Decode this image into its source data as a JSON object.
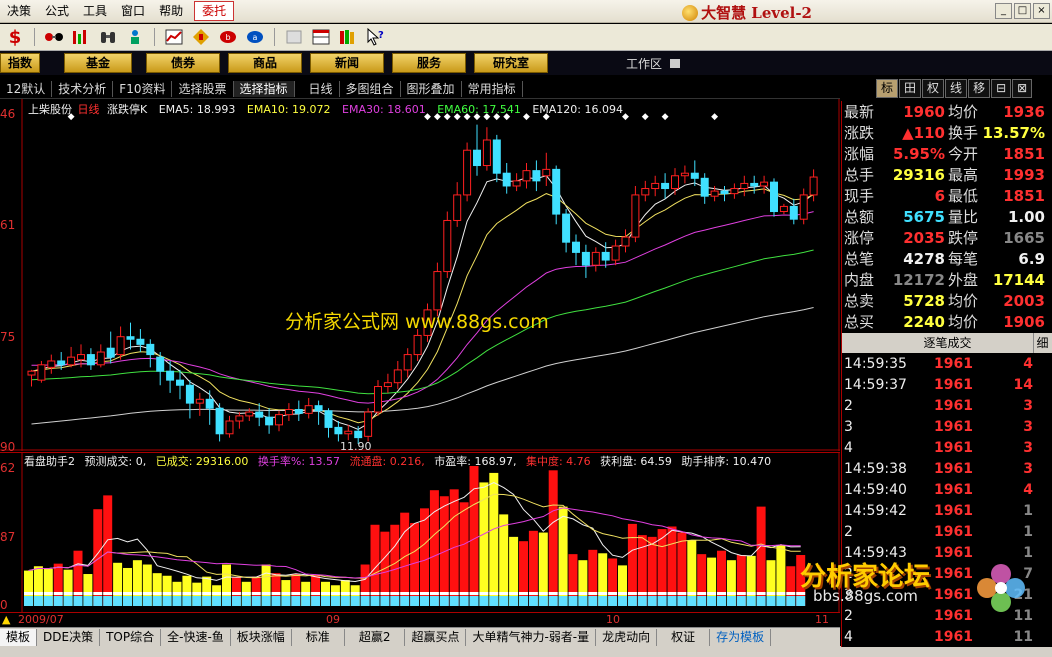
{
  "menu": {
    "items": [
      "决策",
      "公式",
      "工具",
      "窗口",
      "帮助"
    ],
    "active": "委托",
    "brand": "大智慧 Level-2",
    "controls": [
      "_",
      "□",
      "×"
    ]
  },
  "nav": {
    "items": [
      "指数",
      "基金",
      "债券",
      "商品",
      "新闻",
      "服务",
      "研究室"
    ],
    "workarea": "工作区"
  },
  "subtabs": {
    "items": [
      "12默认",
      "技术分析",
      "F10资料",
      "选择股票",
      "选择指标",
      "日线",
      "多图组合",
      "图形叠加",
      "常用指标"
    ],
    "active": "选择指标"
  },
  "right_tabs": {
    "items": [
      "标",
      "田",
      "权",
      "线",
      "移",
      "⊟",
      "⊠"
    ],
    "active": "标"
  },
  "chart_info": {
    "name": "上柴股份",
    "period": "日线",
    "limit": "涨跌停K",
    "ema5": "EMA5: 18.993",
    "ema10": "EMA10: 19.072",
    "ema30": "EMA30: 18.601",
    "ema60": "EMA60: 17.541",
    "ema120": "EMA120: 16.094"
  },
  "price_axis": [
    "46",
    "61",
    "75",
    "90"
  ],
  "volume_axis": [
    "62",
    "87",
    "0"
  ],
  "low_label": "11.90",
  "watermark": "分析家公式网 www.88gs.com",
  "vol_info": {
    "name": "看盘助手2",
    "forecast": "预测成交: 0,",
    "done": "已成交: 29316.00",
    "turnover": "换手率%: 13.57",
    "flow": "流通盘: 0.216,",
    "pe": "市盈率: 168.97,",
    "conc": "集中度: 4.76",
    "profit": "获利盘: 64.59",
    "rank": "助手排序: 10.470"
  },
  "x_axis": [
    "2009/07",
    "09",
    "10",
    "11"
  ],
  "bottom_tabs": {
    "items": [
      "模板",
      "DDE决策",
      "TOP综合",
      "全-快速-鱼",
      "板块涨幅",
      "标准",
      "超赢2",
      "超赢买点",
      "大单精气神力-弱者-量",
      "龙虎动向",
      "权证",
      "存为模板"
    ],
    "active": "模板"
  },
  "quote": {
    "rows": [
      {
        "l1": "最新",
        "v1": "1960",
        "c1": "red",
        "l2": "均价",
        "v2": "1936",
        "c2": "red"
      },
      {
        "l1": "涨跌",
        "v1": "▲110",
        "c1": "red",
        "l2": "换手",
        "v2": "13.57%",
        "c2": "yel"
      },
      {
        "l1": "涨幅",
        "v1": "5.95%",
        "c1": "red",
        "l2": "今开",
        "v2": "1851",
        "c2": "red"
      },
      {
        "l1": "总手",
        "v1": "29316",
        "c1": "yel",
        "l2": "最高",
        "v2": "1993",
        "c2": "red"
      },
      {
        "l1": "现手",
        "v1": "6",
        "c1": "red",
        "l2": "最低",
        "v2": "1851",
        "c2": "red"
      },
      {
        "l1": "总额",
        "v1": "5675",
        "c1": "cyn",
        "l2": "量比",
        "v2": "1.00",
        "c2": "wht"
      },
      {
        "l1": "涨停",
        "v1": "2035",
        "c1": "red",
        "l2": "跌停",
        "v2": "1665",
        "c2": "gry"
      },
      {
        "l1": "总笔",
        "v1": "4278",
        "c1": "wht",
        "l2": "每笔",
        "v2": "6.9",
        "c2": "wht"
      },
      {
        "l1": "内盘",
        "v1": "12172",
        "c1": "gry",
        "l2": "外盘",
        "v2": "17144",
        "c2": "yel"
      },
      {
        "l1": "总卖",
        "v1": "5728",
        "c1": "yel",
        "l2": "均价",
        "v2": "2003",
        "c2": "red"
      },
      {
        "l1": "总买",
        "v1": "2240",
        "c1": "yel",
        "l2": "均价",
        "v2": "1906",
        "c2": "red"
      }
    ],
    "tick_title": "逐笔成交",
    "tick_btn": "细",
    "ticks": [
      {
        "t": "14:59:35",
        "p": "1961",
        "v": "4",
        "c": "red"
      },
      {
        "t": "14:59:37",
        "p": "1961",
        "v": "14",
        "c": "red"
      },
      {
        "t": "2",
        "p": "1961",
        "v": "3",
        "c": "red"
      },
      {
        "t": "3",
        "p": "1961",
        "v": "3",
        "c": "red"
      },
      {
        "t": "4",
        "p": "1961",
        "v": "3",
        "c": "red"
      },
      {
        "t": "14:59:38",
        "p": "1961",
        "v": "3",
        "c": "red"
      },
      {
        "t": "14:59:40",
        "p": "1961",
        "v": "4",
        "c": "red"
      },
      {
        "t": "14:59:42",
        "p": "1961",
        "v": "1",
        "c": "gry"
      },
      {
        "t": "2",
        "p": "1961",
        "v": "1",
        "c": "gry"
      },
      {
        "t": "14:59:43",
        "p": "1961",
        "v": "1",
        "c": "gry"
      },
      {
        "t": "2",
        "p": "1961",
        "v": "7",
        "c": "gry"
      },
      {
        "t": "3",
        "p": "1961",
        "v": "21",
        "c": "gry"
      },
      {
        "t": "2",
        "p": "1961",
        "v": "11",
        "c": "gry"
      },
      {
        "t": "4",
        "p": "1961",
        "v": "11",
        "c": "gry"
      }
    ]
  },
  "logo2": {
    "text": "分析家论坛",
    "url": "bbs.88gs.com"
  },
  "chart_data": {
    "type": "candlestick",
    "price_ylim": [
      16.9,
      19.46
    ],
    "candles": [
      [
        17.44,
        17.47,
        17.35,
        17.48
      ],
      [
        17.4,
        17.52,
        17.38,
        17.55
      ],
      [
        17.5,
        17.55,
        17.45,
        17.6
      ],
      [
        17.55,
        17.52,
        17.48,
        17.62
      ],
      [
        17.52,
        17.58,
        17.5,
        17.66
      ],
      [
        17.56,
        17.6,
        17.5,
        17.68
      ],
      [
        17.6,
        17.52,
        17.48,
        17.65
      ],
      [
        17.52,
        17.62,
        17.5,
        17.68
      ],
      [
        17.65,
        17.58,
        17.53,
        17.78
      ],
      [
        17.6,
        17.74,
        17.56,
        17.82
      ],
      [
        17.74,
        17.72,
        17.64,
        17.85
      ],
      [
        17.72,
        17.68,
        17.62,
        17.8
      ],
      [
        17.68,
        17.6,
        17.5,
        17.72
      ],
      [
        17.58,
        17.47,
        17.36,
        17.62
      ],
      [
        17.47,
        17.4,
        17.3,
        17.55
      ],
      [
        17.4,
        17.36,
        17.25,
        17.48
      ],
      [
        17.36,
        17.22,
        17.1,
        17.4
      ],
      [
        17.22,
        17.25,
        17.12,
        17.3
      ],
      [
        17.25,
        17.18,
        17.05,
        17.32
      ],
      [
        17.18,
        16.98,
        16.92,
        17.22
      ],
      [
        16.98,
        17.08,
        16.95,
        17.12
      ],
      [
        17.08,
        17.12,
        17.02,
        17.15
      ],
      [
        17.12,
        17.15,
        17.08,
        17.18
      ],
      [
        17.15,
        17.11,
        17.04,
        17.22
      ],
      [
        17.11,
        17.05,
        16.98,
        17.18
      ],
      [
        17.05,
        17.13,
        17.0,
        17.16
      ],
      [
        17.13,
        17.17,
        17.08,
        17.22
      ],
      [
        17.17,
        17.14,
        17.08,
        17.24
      ],
      [
        17.14,
        17.2,
        17.1,
        17.26
      ],
      [
        17.2,
        17.16,
        17.05,
        17.24
      ],
      [
        17.16,
        17.03,
        16.95,
        17.18
      ],
      [
        17.03,
        16.98,
        16.92,
        17.08
      ],
      [
        16.98,
        17.0,
        16.93,
        17.05
      ],
      [
        17.0,
        16.95,
        16.9,
        17.04
      ],
      [
        16.96,
        17.15,
        16.92,
        17.18
      ],
      [
        17.15,
        17.35,
        17.12,
        17.4
      ],
      [
        17.35,
        17.38,
        17.3,
        17.45
      ],
      [
        17.38,
        17.48,
        17.33,
        17.55
      ],
      [
        17.48,
        17.6,
        17.42,
        17.65
      ],
      [
        17.6,
        17.75,
        17.55,
        17.8
      ],
      [
        17.75,
        17.95,
        17.7,
        18.0
      ],
      [
        17.95,
        18.25,
        17.9,
        18.32
      ],
      [
        18.25,
        18.65,
        18.2,
        18.72
      ],
      [
        18.65,
        18.85,
        18.6,
        18.95
      ],
      [
        18.85,
        19.2,
        18.8,
        19.26
      ],
      [
        19.2,
        19.08,
        19.0,
        19.4
      ],
      [
        19.08,
        19.28,
        19.04,
        19.38
      ],
      [
        19.28,
        19.02,
        18.95,
        19.32
      ],
      [
        19.02,
        18.92,
        18.86,
        19.1
      ],
      [
        18.92,
        18.96,
        18.88,
        19.02
      ],
      [
        18.96,
        19.04,
        18.9,
        19.1
      ],
      [
        19.04,
        18.96,
        18.88,
        19.12
      ],
      [
        19.0,
        19.05,
        18.92,
        19.18
      ],
      [
        19.05,
        18.7,
        18.62,
        19.08
      ],
      [
        18.7,
        18.48,
        18.4,
        18.74
      ],
      [
        18.48,
        18.4,
        18.3,
        18.54
      ],
      [
        18.4,
        18.3,
        18.2,
        18.46
      ],
      [
        18.3,
        18.4,
        18.25,
        18.44
      ],
      [
        18.4,
        18.34,
        18.28,
        18.48
      ],
      [
        18.34,
        18.45,
        18.3,
        18.5
      ],
      [
        18.45,
        18.52,
        18.4,
        18.58
      ],
      [
        18.52,
        18.85,
        18.48,
        18.92
      ],
      [
        18.85,
        18.9,
        18.8,
        18.96
      ],
      [
        18.9,
        18.94,
        18.84,
        19.0
      ],
      [
        18.94,
        18.9,
        18.82,
        19.02
      ],
      [
        18.9,
        19.0,
        18.85,
        19.06
      ],
      [
        19.0,
        19.02,
        18.94,
        19.08
      ],
      [
        19.02,
        18.98,
        18.92,
        19.12
      ],
      [
        18.98,
        18.84,
        18.78,
        19.02
      ],
      [
        18.84,
        18.88,
        18.8,
        18.92
      ],
      [
        18.88,
        18.86,
        18.8,
        18.92
      ],
      [
        18.86,
        18.9,
        18.82,
        18.94
      ],
      [
        18.9,
        18.94,
        18.84,
        19.0
      ],
      [
        18.94,
        18.92,
        18.86,
        19.0
      ],
      [
        18.92,
        18.95,
        18.86,
        19.0
      ],
      [
        18.95,
        18.72,
        18.68,
        18.98
      ],
      [
        18.72,
        18.76,
        18.7,
        18.78
      ],
      [
        18.76,
        18.66,
        18.62,
        18.82
      ],
      [
        18.66,
        18.85,
        18.62,
        18.9
      ],
      [
        18.85,
        18.99,
        18.8,
        19.05
      ]
    ],
    "volume_ylim": [
      0,
      162
    ],
    "volumes": [
      {
        "v": 41,
        "c": "y"
      },
      {
        "v": 46,
        "c": "y"
      },
      {
        "v": 43,
        "c": "y"
      },
      {
        "v": 49,
        "c": "r"
      },
      {
        "v": 42,
        "c": "y"
      },
      {
        "v": 64,
        "c": "r"
      },
      {
        "v": 37,
        "c": "y"
      },
      {
        "v": 112,
        "c": "r"
      },
      {
        "v": 128,
        "c": "r"
      },
      {
        "v": 50,
        "c": "y"
      },
      {
        "v": 44,
        "c": "y"
      },
      {
        "v": 53,
        "c": "y"
      },
      {
        "v": 48,
        "c": "y"
      },
      {
        "v": 38,
        "c": "y"
      },
      {
        "v": 35,
        "c": "y"
      },
      {
        "v": 28,
        "c": "y"
      },
      {
        "v": 35,
        "c": "y"
      },
      {
        "v": 27,
        "c": "y"
      },
      {
        "v": 34,
        "c": "y"
      },
      {
        "v": 24,
        "c": "y"
      },
      {
        "v": 48,
        "c": "y"
      },
      {
        "v": 33,
        "c": "r"
      },
      {
        "v": 28,
        "c": "y"
      },
      {
        "v": 34,
        "c": "r"
      },
      {
        "v": 48,
        "c": "y"
      },
      {
        "v": 38,
        "c": "r"
      },
      {
        "v": 30,
        "c": "y"
      },
      {
        "v": 37,
        "c": "r"
      },
      {
        "v": 28,
        "c": "y"
      },
      {
        "v": 36,
        "c": "r"
      },
      {
        "v": 28,
        "c": "y"
      },
      {
        "v": 24,
        "c": "y"
      },
      {
        "v": 30,
        "c": "y"
      },
      {
        "v": 24,
        "c": "y"
      },
      {
        "v": 48,
        "c": "r"
      },
      {
        "v": 94,
        "c": "r"
      },
      {
        "v": 86,
        "c": "r"
      },
      {
        "v": 94,
        "c": "r"
      },
      {
        "v": 108,
        "c": "r"
      },
      {
        "v": 96,
        "c": "r"
      },
      {
        "v": 113,
        "c": "r"
      },
      {
        "v": 134,
        "c": "r"
      },
      {
        "v": 127,
        "c": "r"
      },
      {
        "v": 135,
        "c": "r"
      },
      {
        "v": 120,
        "c": "r"
      },
      {
        "v": 162,
        "c": "r"
      },
      {
        "v": 143,
        "c": "y"
      },
      {
        "v": 154,
        "c": "y"
      },
      {
        "v": 106,
        "c": "y"
      },
      {
        "v": 80,
        "c": "y"
      },
      {
        "v": 75,
        "c": "r"
      },
      {
        "v": 87,
        "c": "r"
      },
      {
        "v": 85,
        "c": "y"
      },
      {
        "v": 157,
        "c": "r"
      },
      {
        "v": 115,
        "c": "y"
      },
      {
        "v": 60,
        "c": "r"
      },
      {
        "v": 53,
        "c": "y"
      },
      {
        "v": 65,
        "c": "r"
      },
      {
        "v": 61,
        "c": "y"
      },
      {
        "v": 55,
        "c": "r"
      },
      {
        "v": 47,
        "c": "y"
      },
      {
        "v": 95,
        "c": "r"
      },
      {
        "v": 82,
        "c": "r"
      },
      {
        "v": 80,
        "c": "r"
      },
      {
        "v": 89,
        "c": "r"
      },
      {
        "v": 92,
        "c": "r"
      },
      {
        "v": 85,
        "c": "r"
      },
      {
        "v": 76,
        "c": "y"
      },
      {
        "v": 60,
        "c": "r"
      },
      {
        "v": 56,
        "c": "y"
      },
      {
        "v": 64,
        "c": "r"
      },
      {
        "v": 53,
        "c": "y"
      },
      {
        "v": 59,
        "c": "r"
      },
      {
        "v": 58,
        "c": "y"
      },
      {
        "v": 115,
        "c": "r"
      },
      {
        "v": 53,
        "c": "y"
      },
      {
        "v": 70,
        "c": "y"
      },
      {
        "v": 46,
        "c": "r"
      },
      {
        "v": 59,
        "c": "r"
      }
    ]
  },
  "colors": {
    "up": "#ff2020",
    "down": "#40e0ff",
    "ema5": "#f0f0f0",
    "ema10": "#f0e060",
    "ema30": "#e040e0",
    "ema60": "#40e040",
    "ema120": "#d0d0d0",
    "vol_up": "#ff1010",
    "vol_down": "#ffff20",
    "vol_base": "#60e0ff"
  }
}
